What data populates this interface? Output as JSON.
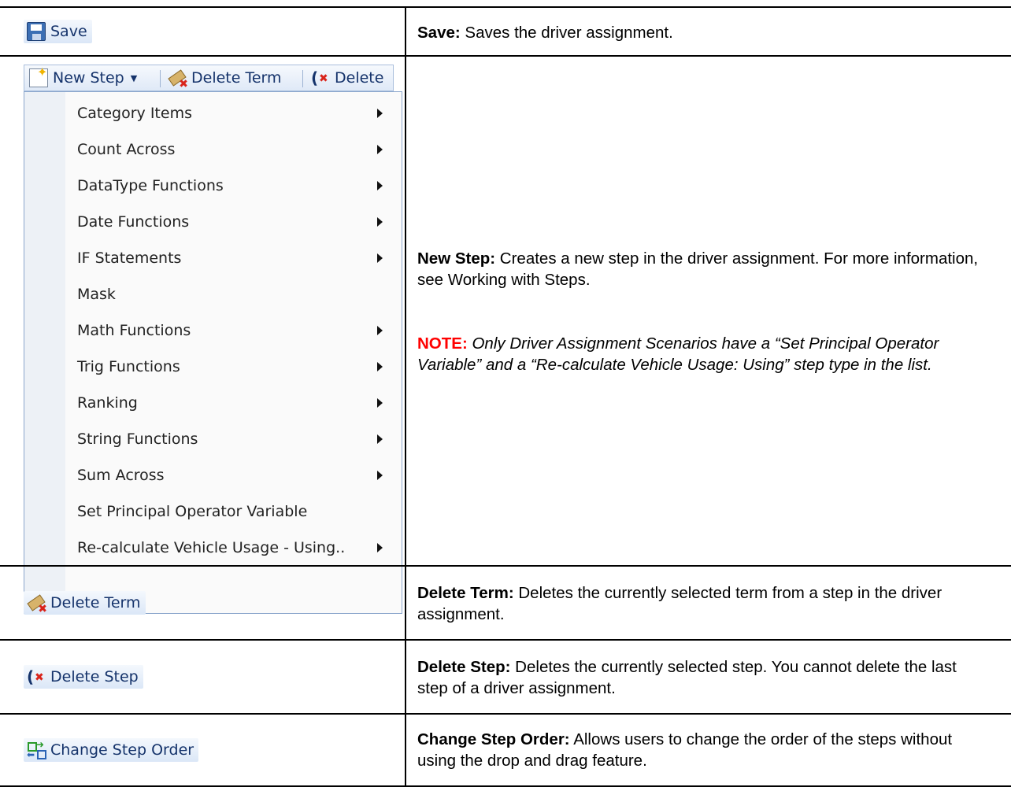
{
  "rows": [
    {
      "left": {
        "icon": "save-disk-icon",
        "label": "Save"
      },
      "right": {
        "term": "Save:",
        "text": " Saves the driver assignment."
      }
    },
    {
      "left": {
        "toolbar": {
          "new_step": "New Step",
          "delete_term": "Delete Term",
          "delete_truncated": "Delete"
        },
        "menu": [
          {
            "label": "Category Items",
            "submenu": true
          },
          {
            "label": "Count Across",
            "submenu": true
          },
          {
            "label": "DataType Functions",
            "submenu": true
          },
          {
            "label": "Date Functions",
            "submenu": true
          },
          {
            "label": "IF Statements",
            "submenu": true
          },
          {
            "label": "Mask",
            "submenu": false
          },
          {
            "label": "Math Functions",
            "submenu": true
          },
          {
            "label": "Trig Functions",
            "submenu": true
          },
          {
            "label": "Ranking",
            "submenu": true
          },
          {
            "label": "String Functions",
            "submenu": true
          },
          {
            "label": "Sum Across",
            "submenu": true
          },
          {
            "label": "Set Principal Operator Variable",
            "submenu": false
          },
          {
            "label": "Re-calculate Vehicle Usage - Using..",
            "submenu": true
          }
        ]
      },
      "right": {
        "term": "New Step:",
        "text": " Creates a new step in the driver assignment. For more information, see Working with Steps.",
        "note_label": "NOTE:",
        "note_text": " Only Driver Assignment Scenarios have a “Set Principal Operator Variable” and a “Re-calculate Vehicle Usage: Using” step type in the list."
      }
    },
    {
      "left": {
        "icon": "delete-term-icon",
        "label": "Delete Term"
      },
      "right": {
        "term": "Delete Term:",
        "text": " Deletes the currently selected term from a step in the driver assignment."
      }
    },
    {
      "left": {
        "icon": "delete-step-icon",
        "label": "Delete Step"
      },
      "right": {
        "term": "Delete Step:",
        "text": " Deletes the currently selected step. You cannot delete the last step of a driver assignment."
      }
    },
    {
      "left": {
        "icon": "change-step-order-icon",
        "label": "Change Step Order"
      },
      "right": {
        "term": "Change Step Order:",
        "text": " Allows users to change the order of the steps without using the drop and drag feature."
      }
    }
  ]
}
